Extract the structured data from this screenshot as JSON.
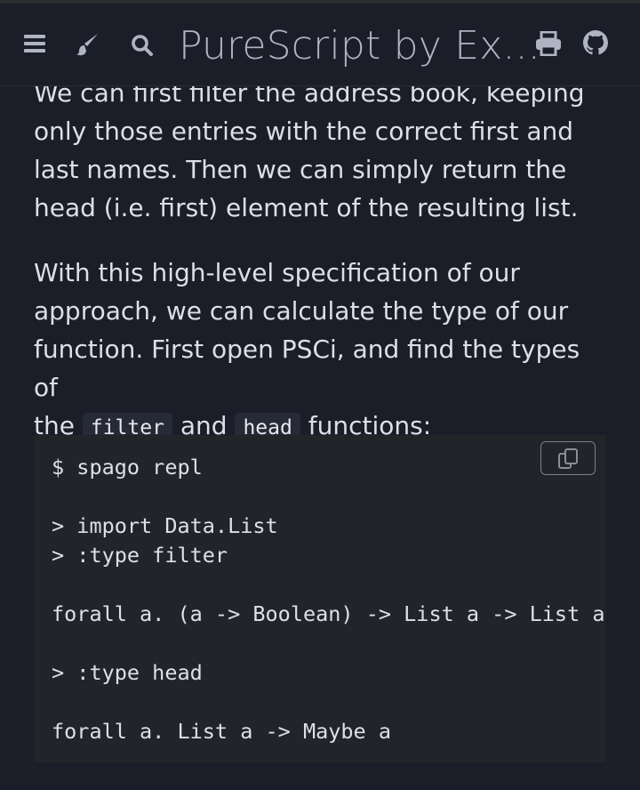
{
  "header": {
    "title": "PureScript by Ex...",
    "icons": [
      "menu-icon",
      "paintbrush-icon",
      "search-icon",
      "print-icon",
      "github-icon"
    ]
  },
  "content": {
    "paragraph1": [
      "We can first filter the address book, keeping",
      "only those entries with the correct first and",
      "last names. Then we can simply return the",
      "head (i.e. first) element of the resulting list."
    ],
    "paragraph2": {
      "lines": [
        "With this high-level specification of our",
        "approach, we can calculate the type of our",
        "function. First open PSCi, and find the types of"
      ],
      "last_prefix": "the ",
      "code1": "filter",
      "mid": " and ",
      "code2": "head",
      "suffix": " functions:"
    },
    "code_block": "$ spago repl\n\n> import Data.List\n> :type filter\n\nforall a. (a -> Boolean) -> List a -> List a\n\n> :type head\n\nforall a. List a -> Maybe a"
  },
  "colors": {
    "background": "#1b1d29",
    "text": "#dcdfe8",
    "icon": "#aeb4c2",
    "code_bg": "#23242a"
  }
}
